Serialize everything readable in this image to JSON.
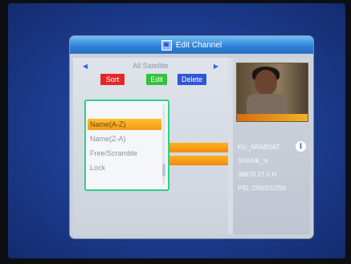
{
  "window": {
    "title": "Edit Channel"
  },
  "satellite": {
    "label": "All Satellite",
    "prev_arrow": "◀",
    "next_arrow": "▶"
  },
  "buttons": {
    "sort": "Sort",
    "edit": "Edit",
    "delete": "Delete"
  },
  "sort_menu": {
    "items": [
      "Name(A-Z)",
      "Name(Z-A)",
      "Free/Scramble",
      "Lock"
    ],
    "selected_index": 0
  },
  "channel_info": {
    "lines": [
      "KU_ARABSAT",
      "SHANK_tv",
      "38870 27.5 H",
      "PID: 256/0/1/256"
    ],
    "info_glyph": "i"
  },
  "colors": {
    "accent": "#2d7fd8",
    "highlight": "#f49a14",
    "sort_button": "#e4282a",
    "edit_button": "#31c33a",
    "delete_button": "#2e58d8",
    "menu_border": "#2fcf8a"
  }
}
